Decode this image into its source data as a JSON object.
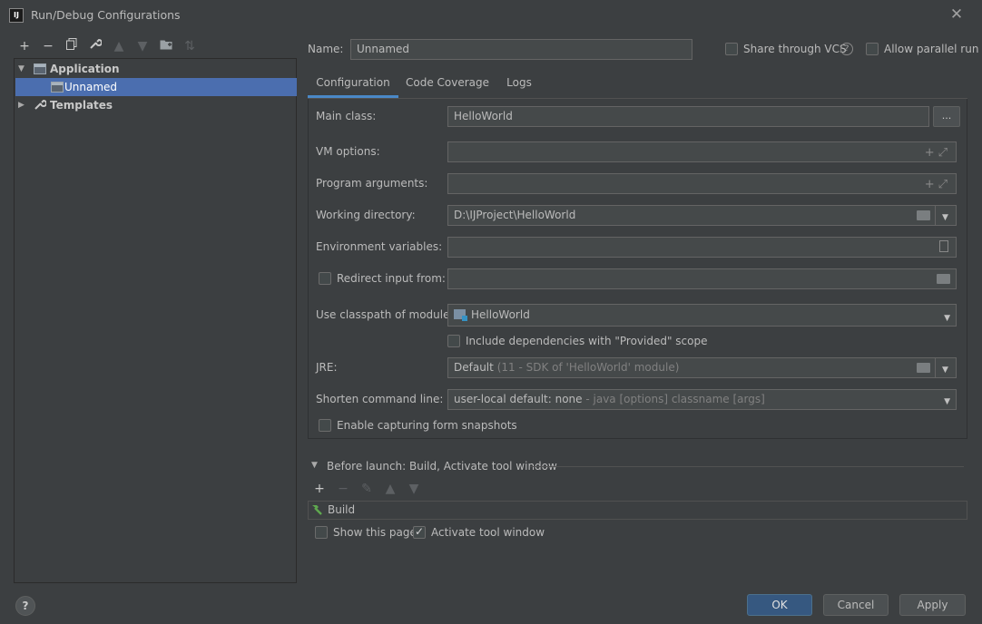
{
  "window": {
    "app_icon_text": "IJ",
    "title": "Run/Debug Configurations"
  },
  "toolbar": {
    "add": "+",
    "remove": "−",
    "copy": "copy-icon",
    "edit_defaults": "wrench-icon",
    "move_up": "arrow-up-icon",
    "move_down": "arrow-down-icon",
    "folder": "folder-add-icon",
    "sort": "sort-icon"
  },
  "tree": {
    "application": "Application",
    "unnamed": "Unnamed",
    "templates": "Templates"
  },
  "name": {
    "label": "Name:",
    "value": "Unnamed"
  },
  "options": {
    "share_vcs": "Share through VCS",
    "share_vcs_checked": false,
    "allow_parallel": "Allow parallel run",
    "allow_parallel_checked": false,
    "help": "?"
  },
  "tabs": [
    {
      "label": "Configuration",
      "active": true
    },
    {
      "label": "Code Coverage",
      "active": false
    },
    {
      "label": "Logs",
      "active": false
    }
  ],
  "config": {
    "main_class_label": "Main class:",
    "main_class_value": "HelloWorld",
    "browse_button": "...",
    "vm_options_label": "VM options:",
    "vm_options_value": "",
    "program_args_label": "Program arguments:",
    "program_args_value": "",
    "working_dir_label": "Working directory:",
    "working_dir_value": "D:\\IJProject\\HelloWorld",
    "env_vars_label": "Environment variables:",
    "env_vars_value": "",
    "redirect_label": "Redirect input from:",
    "redirect_checked": false,
    "redirect_value": "",
    "classpath_label": "Use classpath of module:",
    "classpath_value": "HelloWorld",
    "include_provided_label": "Include dependencies with \"Provided\" scope",
    "include_provided_checked": false,
    "jre_label": "JRE:",
    "jre_value": "Default",
    "jre_hint": "(11 - SDK of 'HelloWorld' module)",
    "shorten_label": "Shorten command line:",
    "shorten_value": "user-local default: none",
    "shorten_hint": "- java [options] classname [args]",
    "snapshots_label": "Enable capturing form snapshots",
    "snapshots_checked": false
  },
  "before_launch": {
    "title": "Before launch: Build, Activate tool window",
    "build_item": "Build",
    "show_page_label": "Show this page",
    "show_page_checked": false,
    "activate_label": "Activate tool window",
    "activate_checked": true
  },
  "buttons": {
    "help": "?",
    "ok": "OK",
    "cancel": "Cancel",
    "apply": "Apply"
  },
  "colors": {
    "background": "#3c3f41",
    "selection": "#4b6eaf",
    "primary_button": "#365880",
    "tab_underline": "#4a88c7"
  }
}
